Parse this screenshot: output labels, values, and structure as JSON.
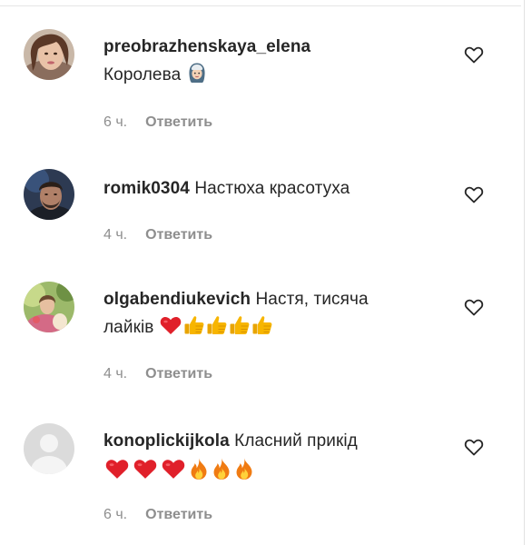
{
  "comments": [
    {
      "username": "preobrazhenskaya_elena",
      "text": "Королева",
      "emoji": [
        "woman-with-headscarf"
      ],
      "time": "6 ч.",
      "reply": "Ответить"
    },
    {
      "username": "romik0304",
      "text": "Настюха красотуха",
      "emoji": [],
      "time": "4 ч.",
      "reply": "Ответить"
    },
    {
      "username": "olgabendiukevich",
      "text": "Настя, тисяча",
      "text2": "лайків",
      "emoji": [
        "red-heart",
        "thumbs-up",
        "thumbs-up",
        "thumbs-up",
        "thumbs-up"
      ],
      "time": "4 ч.",
      "reply": "Ответить"
    },
    {
      "username": "konoplickijkola",
      "text": "Класний прикід",
      "emoji": [
        "red-heart",
        "red-heart",
        "red-heart",
        "fire",
        "fire",
        "fire"
      ],
      "time": "6 ч.",
      "reply": "Ответить"
    }
  ],
  "colors": {
    "primary_text": "#262626",
    "secondary_text": "#8e8e8e",
    "heart_emoji": "#e0202a",
    "thumbs_emoji": "#f2b200",
    "fire_emoji": "#f07b12"
  }
}
